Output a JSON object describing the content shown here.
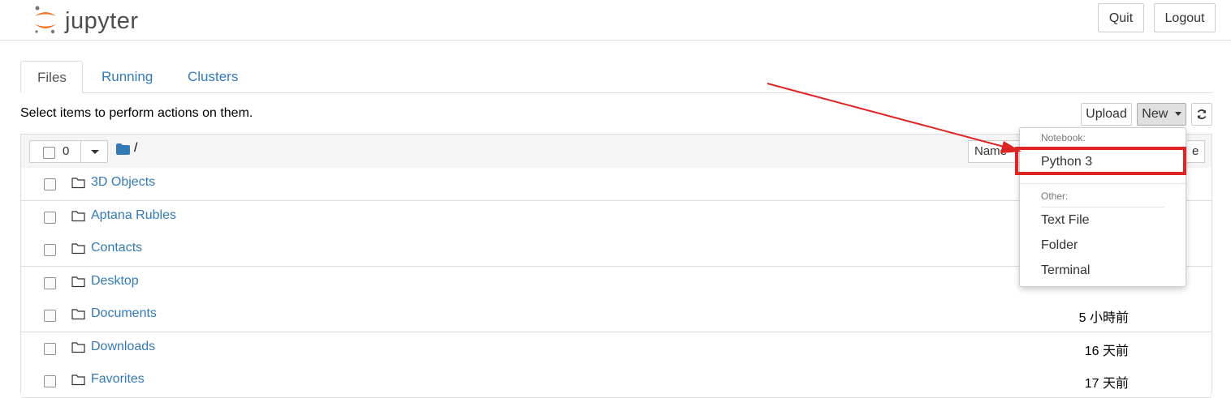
{
  "header": {
    "logo_text": "jupyter",
    "quit_label": "Quit",
    "logout_label": "Logout"
  },
  "tabs": [
    {
      "label": "Files",
      "active": true
    },
    {
      "label": "Running",
      "active": false
    },
    {
      "label": "Clusters",
      "active": false
    }
  ],
  "toolbar": {
    "hint": "Select items to perform actions on them.",
    "upload_label": "Upload",
    "new_label": "New",
    "refresh_icon": "refresh-icon"
  },
  "list_header": {
    "selected_count": "0",
    "path": "/",
    "name_sort_label": "Name",
    "last_modified_fragment": "e"
  },
  "files": [
    {
      "name": "3D Objects",
      "modified": ""
    },
    {
      "name": "Aptana Rubles",
      "modified": ""
    },
    {
      "name": "Contacts",
      "modified": ""
    },
    {
      "name": "Desktop",
      "modified": ""
    },
    {
      "name": "Documents",
      "modified": "5 小時前"
    },
    {
      "name": "Downloads",
      "modified": "16 天前"
    },
    {
      "name": "Favorites",
      "modified": "17 天前"
    }
  ],
  "new_menu": {
    "notebook_header": "Notebook:",
    "python3": "Python 3",
    "other_header": "Other:",
    "text_file": "Text File",
    "folder": "Folder",
    "terminal": "Terminal"
  },
  "colors": {
    "link": "#337ab7",
    "annotation_red": "#e02424",
    "logo_orange": "#f37626"
  }
}
